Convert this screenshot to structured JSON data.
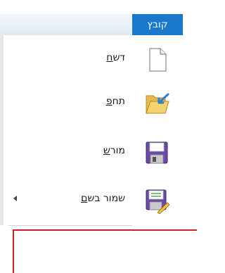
{
  "ribbon": {
    "file_tab_label": "קובץ",
    "accent_color": "#1979ca"
  },
  "menu": {
    "items": [
      {
        "label": "חדש",
        "mnemonic": "ח",
        "rest": "דש",
        "icon": "new-document-icon"
      },
      {
        "label": "פתח",
        "mnemonic": "פ",
        "rest": "תח",
        "icon": "open-folder-icon"
      },
      {
        "label": "שמור",
        "mnemonic": "ש",
        "rest": "מור",
        "icon": "save-floppy-icon"
      },
      {
        "label": "שמור בשם",
        "mnemonic": "ם",
        "rest": "שמור בש",
        "icon": "save-as-icon",
        "has_submenu": true
      }
    ]
  },
  "colors": {
    "highlight_box": "#cc1f1f"
  }
}
